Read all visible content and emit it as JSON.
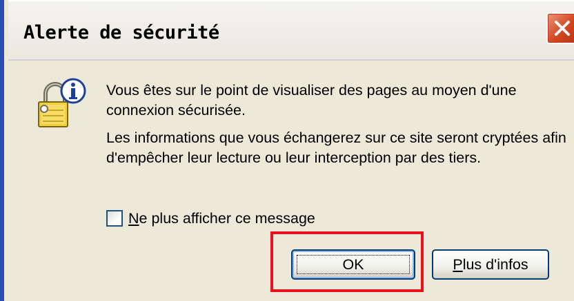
{
  "dialog": {
    "title": "Alerte de sécurité",
    "close_icon": "close-icon",
    "icon": "padlock-info-icon",
    "message_line1": "Vous êtes sur le point de visualiser des pages au moyen d'une connexion sécurisée.",
    "message_line2": "Les informations que vous échangerez sur ce site seront cryptées afin d'empêcher leur lecture ou leur interception par des tiers.",
    "checkbox_label": "Ne plus afficher ce message",
    "checkbox_checked": false,
    "ok_label": "OK",
    "more_info_label": "Plus d'infos"
  },
  "colors": {
    "dialog_bg": "#ece9d8",
    "close_button": "#d2461f",
    "button_border": "#003c74",
    "highlight": "#e8101a"
  }
}
